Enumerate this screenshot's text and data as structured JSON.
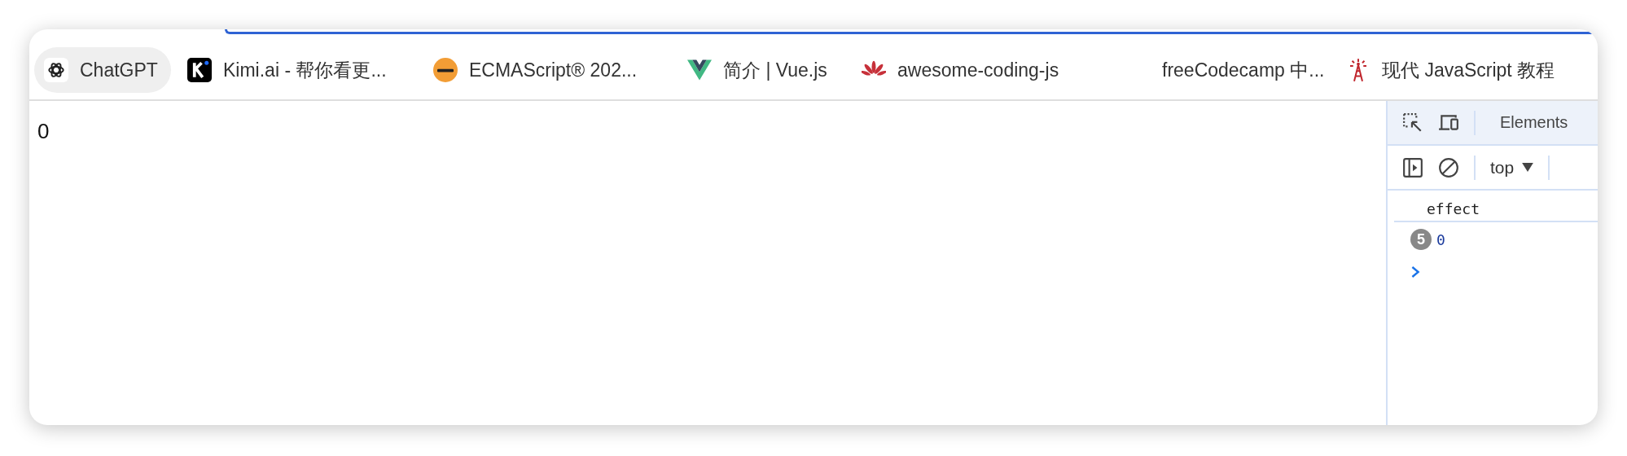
{
  "bookmarks": [
    {
      "label": "ChatGPT",
      "selected": true
    },
    {
      "label": "Kimi.ai - 帮你看更...",
      "selected": false
    },
    {
      "label": "ECMAScript® 202...",
      "selected": false
    },
    {
      "label": "简介 | Vue.js",
      "selected": false
    },
    {
      "label": "awesome-coding-js",
      "selected": false
    },
    {
      "label": "freeCodecamp 中...",
      "selected": false
    },
    {
      "label": "现代 JavaScript 教程",
      "selected": false
    }
  ],
  "page": {
    "output": "0"
  },
  "devtools": {
    "tabs": [
      {
        "label": "Elements"
      }
    ],
    "context": "top",
    "console": [
      {
        "kind": "log",
        "text": "effect"
      },
      {
        "kind": "repeat",
        "count": "5",
        "text": "0"
      }
    ]
  }
}
